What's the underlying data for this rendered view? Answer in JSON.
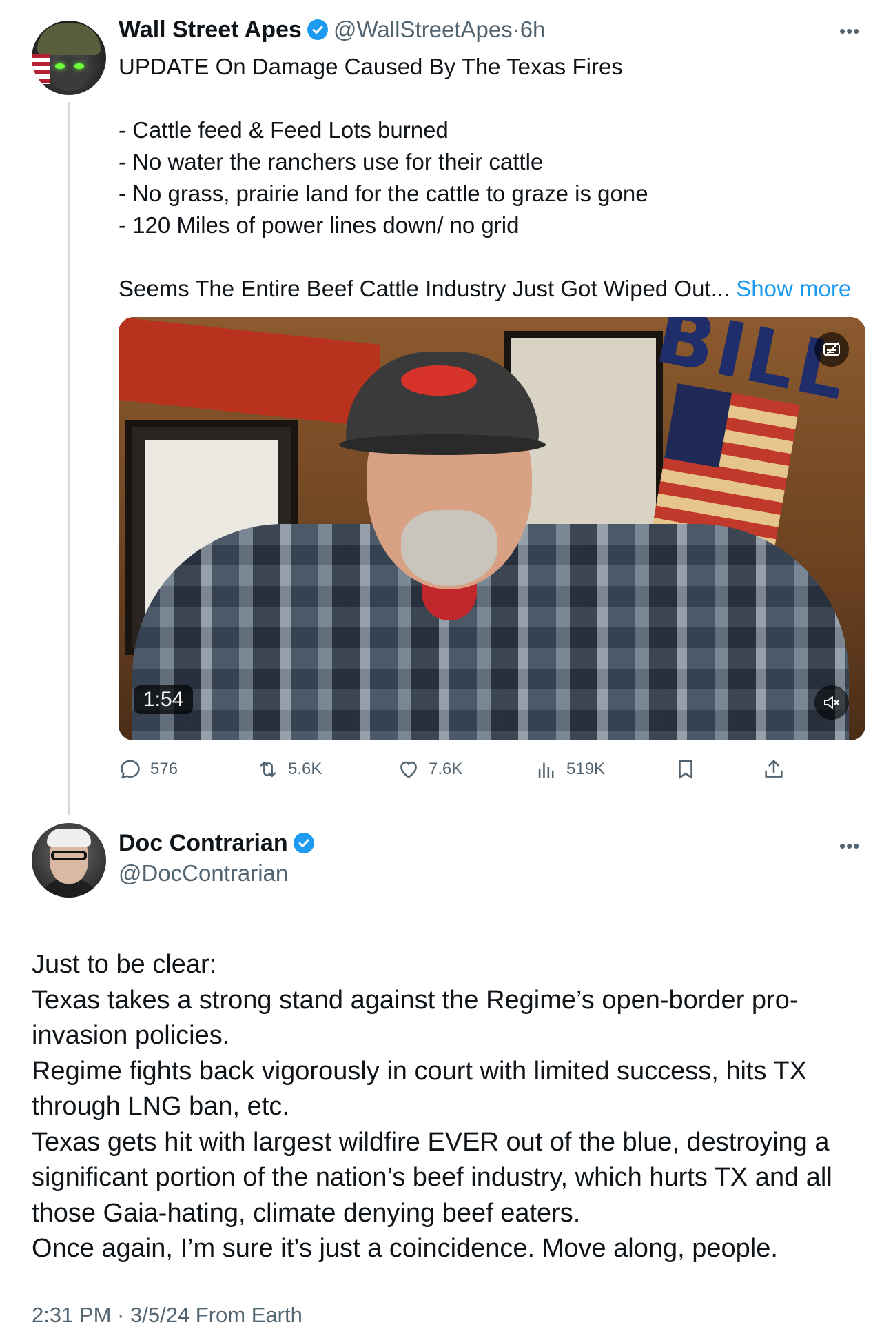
{
  "quoted_tweet": {
    "author_name": "Wall Street Apes",
    "handle": "@WallStreetApes",
    "time": "6h",
    "separator": "·",
    "lines": [
      "UPDATE On Damage Caused By The Texas Fires",
      "",
      "- Cattle feed & Feed Lots burned",
      "- No water the ranchers use for their cattle",
      "- No grass, prairie land for the cattle to graze is gone",
      "- 120 Miles of power lines down/ no grid",
      ""
    ],
    "last_line": "Seems The Entire Beef Cattle Industry Just Got Wiped Out...",
    "show_more": "Show more",
    "video": {
      "duration": "1:54",
      "sign_text": "BILL"
    },
    "actions": {
      "replies": "576",
      "reposts": "5.6K",
      "likes": "7.6K",
      "views": "519K"
    }
  },
  "main_tweet": {
    "author_name": "Doc Contrarian",
    "handle": "@DocContrarian",
    "paragraphs": [
      "Just to be clear:",
      "Texas takes a strong stand against the Regime’s open-border pro-invasion policies.",
      "Regime fights back vigorously in court with limited success, hits TX through LNG ban, etc.",
      "Texas gets hit with largest wildfire EVER out of the blue, destroying a significant portion of the nation’s beef industry, which hurts TX and all those Gaia-hating, climate denying beef eaters.",
      "Once again, I’m sure it’s just a coincidence. Move along, people."
    ],
    "timestamp": "2:31 PM · 3/5/24 From Earth"
  },
  "icons": {
    "more": "more-horizontal-icon",
    "verified": "verified-badge-icon",
    "reply": "reply-icon",
    "repost": "repost-icon",
    "like": "heart-icon",
    "views": "views-icon",
    "bookmark": "bookmark-icon",
    "share": "share-icon",
    "captions": "captions-icon",
    "mute": "mute-icon"
  },
  "colors": {
    "accent": "#1d9bf0",
    "secondary_text": "#536471",
    "primary_text": "#0f1419",
    "thread_line": "#cfd9de"
  }
}
